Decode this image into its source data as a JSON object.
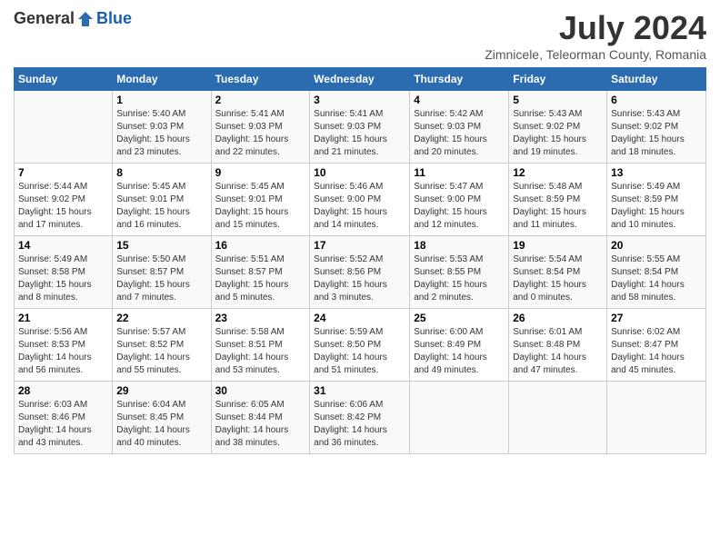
{
  "logo": {
    "general": "General",
    "blue": "Blue"
  },
  "title": "July 2024",
  "location": "Zimnicele, Teleorman County, Romania",
  "days_header": [
    "Sunday",
    "Monday",
    "Tuesday",
    "Wednesday",
    "Thursday",
    "Friday",
    "Saturday"
  ],
  "weeks": [
    [
      {
        "day": "",
        "info": ""
      },
      {
        "day": "1",
        "info": "Sunrise: 5:40 AM\nSunset: 9:03 PM\nDaylight: 15 hours\nand 23 minutes."
      },
      {
        "day": "2",
        "info": "Sunrise: 5:41 AM\nSunset: 9:03 PM\nDaylight: 15 hours\nand 22 minutes."
      },
      {
        "day": "3",
        "info": "Sunrise: 5:41 AM\nSunset: 9:03 PM\nDaylight: 15 hours\nand 21 minutes."
      },
      {
        "day": "4",
        "info": "Sunrise: 5:42 AM\nSunset: 9:03 PM\nDaylight: 15 hours\nand 20 minutes."
      },
      {
        "day": "5",
        "info": "Sunrise: 5:43 AM\nSunset: 9:02 PM\nDaylight: 15 hours\nand 19 minutes."
      },
      {
        "day": "6",
        "info": "Sunrise: 5:43 AM\nSunset: 9:02 PM\nDaylight: 15 hours\nand 18 minutes."
      }
    ],
    [
      {
        "day": "7",
        "info": "Sunrise: 5:44 AM\nSunset: 9:02 PM\nDaylight: 15 hours\nand 17 minutes."
      },
      {
        "day": "8",
        "info": "Sunrise: 5:45 AM\nSunset: 9:01 PM\nDaylight: 15 hours\nand 16 minutes."
      },
      {
        "day": "9",
        "info": "Sunrise: 5:45 AM\nSunset: 9:01 PM\nDaylight: 15 hours\nand 15 minutes."
      },
      {
        "day": "10",
        "info": "Sunrise: 5:46 AM\nSunset: 9:00 PM\nDaylight: 15 hours\nand 14 minutes."
      },
      {
        "day": "11",
        "info": "Sunrise: 5:47 AM\nSunset: 9:00 PM\nDaylight: 15 hours\nand 12 minutes."
      },
      {
        "day": "12",
        "info": "Sunrise: 5:48 AM\nSunset: 8:59 PM\nDaylight: 15 hours\nand 11 minutes."
      },
      {
        "day": "13",
        "info": "Sunrise: 5:49 AM\nSunset: 8:59 PM\nDaylight: 15 hours\nand 10 minutes."
      }
    ],
    [
      {
        "day": "14",
        "info": "Sunrise: 5:49 AM\nSunset: 8:58 PM\nDaylight: 15 hours\nand 8 minutes."
      },
      {
        "day": "15",
        "info": "Sunrise: 5:50 AM\nSunset: 8:57 PM\nDaylight: 15 hours\nand 7 minutes."
      },
      {
        "day": "16",
        "info": "Sunrise: 5:51 AM\nSunset: 8:57 PM\nDaylight: 15 hours\nand 5 minutes."
      },
      {
        "day": "17",
        "info": "Sunrise: 5:52 AM\nSunset: 8:56 PM\nDaylight: 15 hours\nand 3 minutes."
      },
      {
        "day": "18",
        "info": "Sunrise: 5:53 AM\nSunset: 8:55 PM\nDaylight: 15 hours\nand 2 minutes."
      },
      {
        "day": "19",
        "info": "Sunrise: 5:54 AM\nSunset: 8:54 PM\nDaylight: 15 hours\nand 0 minutes."
      },
      {
        "day": "20",
        "info": "Sunrise: 5:55 AM\nSunset: 8:54 PM\nDaylight: 14 hours\nand 58 minutes."
      }
    ],
    [
      {
        "day": "21",
        "info": "Sunrise: 5:56 AM\nSunset: 8:53 PM\nDaylight: 14 hours\nand 56 minutes."
      },
      {
        "day": "22",
        "info": "Sunrise: 5:57 AM\nSunset: 8:52 PM\nDaylight: 14 hours\nand 55 minutes."
      },
      {
        "day": "23",
        "info": "Sunrise: 5:58 AM\nSunset: 8:51 PM\nDaylight: 14 hours\nand 53 minutes."
      },
      {
        "day": "24",
        "info": "Sunrise: 5:59 AM\nSunset: 8:50 PM\nDaylight: 14 hours\nand 51 minutes."
      },
      {
        "day": "25",
        "info": "Sunrise: 6:00 AM\nSunset: 8:49 PM\nDaylight: 14 hours\nand 49 minutes."
      },
      {
        "day": "26",
        "info": "Sunrise: 6:01 AM\nSunset: 8:48 PM\nDaylight: 14 hours\nand 47 minutes."
      },
      {
        "day": "27",
        "info": "Sunrise: 6:02 AM\nSunset: 8:47 PM\nDaylight: 14 hours\nand 45 minutes."
      }
    ],
    [
      {
        "day": "28",
        "info": "Sunrise: 6:03 AM\nSunset: 8:46 PM\nDaylight: 14 hours\nand 43 minutes."
      },
      {
        "day": "29",
        "info": "Sunrise: 6:04 AM\nSunset: 8:45 PM\nDaylight: 14 hours\nand 40 minutes."
      },
      {
        "day": "30",
        "info": "Sunrise: 6:05 AM\nSunset: 8:44 PM\nDaylight: 14 hours\nand 38 minutes."
      },
      {
        "day": "31",
        "info": "Sunrise: 6:06 AM\nSunset: 8:42 PM\nDaylight: 14 hours\nand 36 minutes."
      },
      {
        "day": "",
        "info": ""
      },
      {
        "day": "",
        "info": ""
      },
      {
        "day": "",
        "info": ""
      }
    ]
  ]
}
